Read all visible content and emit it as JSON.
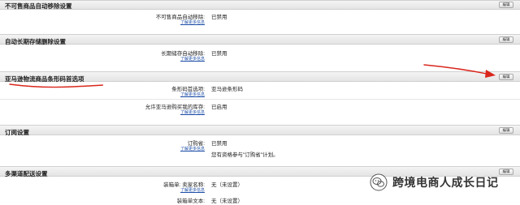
{
  "sections": [
    {
      "title": "不可售商品自动移除设置",
      "edit_label": "编辑",
      "rows": [
        {
          "label": "不可售商品自动移除:",
          "value": "已禁用",
          "learn": "了解更多信息"
        }
      ]
    },
    {
      "title": "自动长期存储删除设置",
      "edit_label": "编辑",
      "rows": [
        {
          "label": "长期储存自动移除:",
          "value": "已禁用",
          "learn": "了解更多信息"
        }
      ]
    },
    {
      "title": "亚马逊物流商品条形码首选项",
      "edit_label": "编辑",
      "rows": [
        {
          "label": "条形码首选项:",
          "value": "亚马逊条形码",
          "learn": "了解更多信息"
        },
        {
          "label": "允许亚马逊购买我的库存:",
          "value": "已启用",
          "learn": "了解更多信息"
        }
      ]
    },
    {
      "title": "订阅设置",
      "edit_label": "编辑",
      "rows": [
        {
          "label": "订购省:",
          "value": "已禁用",
          "learn": "了解更多信息",
          "note": "您有资格参与\"订购省\"计划。"
        }
      ]
    },
    {
      "title": "多渠道配送设置",
      "edit_label": "编辑",
      "rows": [
        {
          "label": "装箱单: 卖家名称:",
          "value": "无（未设置）",
          "learn": "了解更多信息"
        },
        {
          "label": "装箱单文本:",
          "value": "无（未设置）",
          "learn": ""
        }
      ]
    }
  ],
  "watermark": {
    "text": "跨境电商人成长日记",
    "icon": "wechat-icon"
  },
  "annotations": {
    "underline_color": "#d9261c",
    "arrow_color": "#d9261c"
  }
}
